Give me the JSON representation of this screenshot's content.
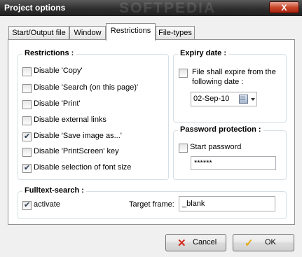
{
  "window": {
    "title": "Project options",
    "watermark": "SOFTPEDIA",
    "close_glyph": "X"
  },
  "tabs": [
    {
      "label": "Start/Output file"
    },
    {
      "label": "Window"
    },
    {
      "label": "Restrictions"
    },
    {
      "label": "File-types"
    }
  ],
  "active_tab": "Restrictions",
  "restrictions": {
    "title": "Restrictions :",
    "items": [
      {
        "label": "Disable 'Copy'",
        "checked": false
      },
      {
        "label": "Disable 'Search (on this page)'",
        "checked": false
      },
      {
        "label": "Disable 'Print'",
        "checked": false
      },
      {
        "label": "Disable external links",
        "checked": false
      },
      {
        "label": "Disable 'Save image as...'",
        "checked": true
      },
      {
        "label": "Disable 'PrintScreen' key",
        "checked": false
      },
      {
        "label": "Disable selection of font size",
        "checked": true
      }
    ]
  },
  "expiry": {
    "title": "Expiry date :",
    "checkbox_label_line1": "File shall expire from the",
    "checkbox_label_line2": "following date :",
    "checked": false,
    "date_value": "02-Sep-10"
  },
  "password": {
    "title": "Password protection :",
    "checkbox_label": "Start password",
    "checked": false,
    "value": "******"
  },
  "fulltext": {
    "title": "Fulltext-search :",
    "activate_label": "activate",
    "activate_checked": true,
    "target_label": "Target frame:",
    "target_value": "_blank"
  },
  "buttons": {
    "cancel_label": "Cancel",
    "ok_label": "OK",
    "cancel_icon_color": "#d42a1c",
    "ok_icon_color": "#e0a810"
  }
}
